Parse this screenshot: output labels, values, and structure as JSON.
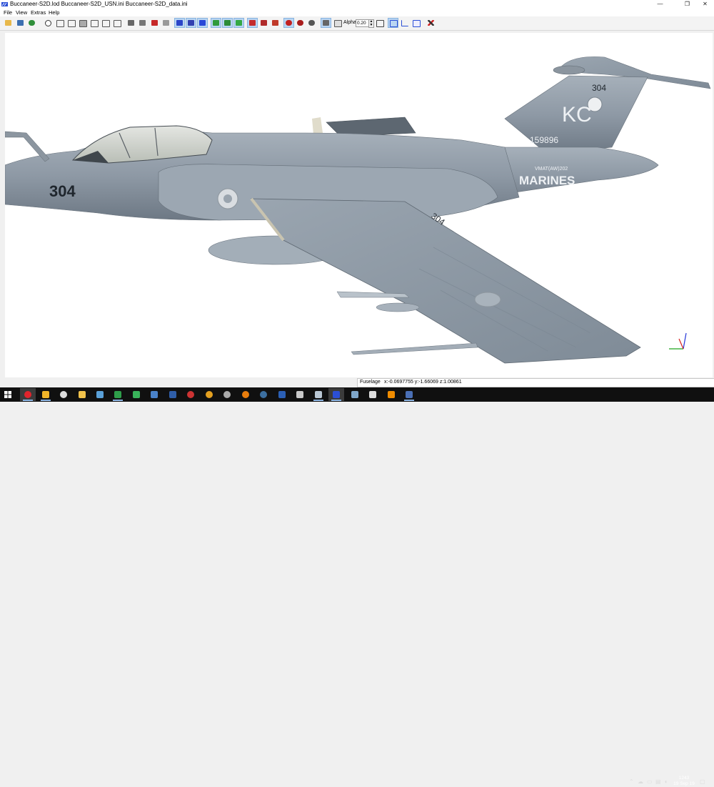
{
  "window": {
    "title": "Buccaneer-S2D.lod  Buccaneer-S2D_USN.ini  Buccaneer-S2D_data.ini",
    "minimize_glyph": "—",
    "restore_glyph": "❐",
    "close_glyph": "✕"
  },
  "menu": [
    "File",
    "View",
    "Extras",
    "Help"
  ],
  "toolbar": {
    "alpha_label": "Alpha:",
    "alpha_value": "0.20",
    "spin_up": "▲",
    "spin_down": "▼"
  },
  "model": {
    "tail_number": "304",
    "fin_letters": "KC",
    "fin_code": "304",
    "serial": "159896",
    "squadron": "VMAT(AW)202",
    "service": "MARINES",
    "wing_number": "304"
  },
  "status": {
    "object": "Fuselage",
    "coords": "x:-0.0697755 y:-1.66069 z:1.00861"
  },
  "clock": {
    "time": "1243",
    "date": "19 Sep 19"
  },
  "colors": {
    "accent": "#2b4fd6",
    "fuselage": "#8e9aa6",
    "taskbar": "#101010"
  }
}
